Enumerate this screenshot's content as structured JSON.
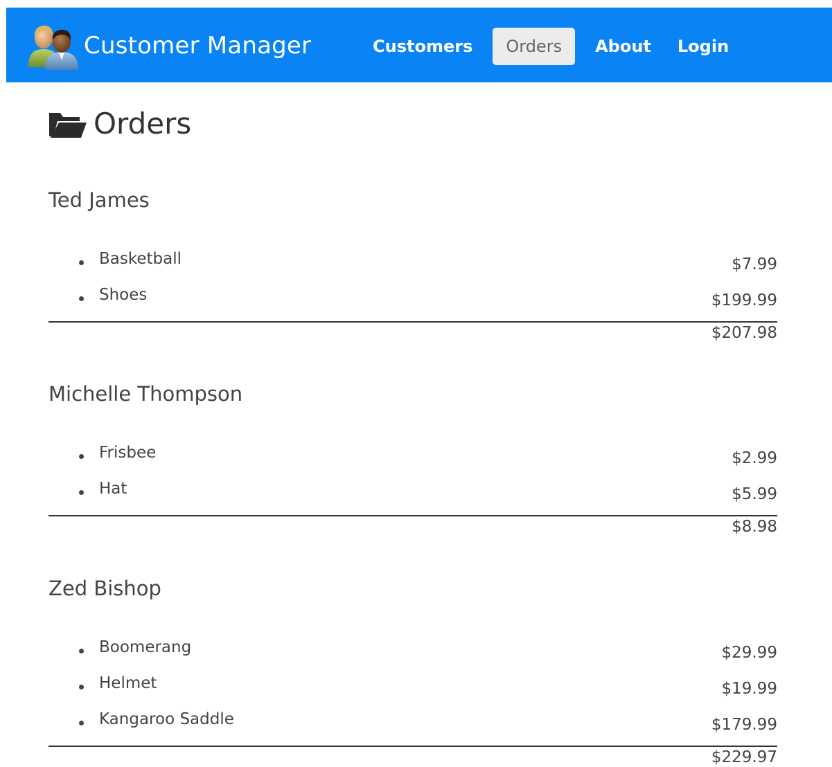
{
  "app": {
    "title": "Customer Manager",
    "brand_color": "#0a84f5"
  },
  "nav": {
    "items": [
      {
        "label": "Customers",
        "active": false
      },
      {
        "label": "Orders",
        "active": true
      },
      {
        "label": "About",
        "active": false
      },
      {
        "label": "Login",
        "active": false
      }
    ]
  },
  "page": {
    "title": "Orders",
    "icon": "folder-open-icon"
  },
  "customers": [
    {
      "name": "Ted James",
      "orders": [
        {
          "product": "Basketball",
          "price": "$7.99"
        },
        {
          "product": "Shoes",
          "price": "$199.99"
        }
      ],
      "total": "$207.98"
    },
    {
      "name": "Michelle Thompson",
      "orders": [
        {
          "product": "Frisbee",
          "price": "$2.99"
        },
        {
          "product": "Hat",
          "price": "$5.99"
        }
      ],
      "total": "$8.98"
    },
    {
      "name": "Zed Bishop",
      "orders": [
        {
          "product": "Boomerang",
          "price": "$29.99"
        },
        {
          "product": "Helmet",
          "price": "$19.99"
        },
        {
          "product": "Kangaroo Saddle",
          "price": "$179.99"
        }
      ],
      "total": "$229.97"
    }
  ]
}
